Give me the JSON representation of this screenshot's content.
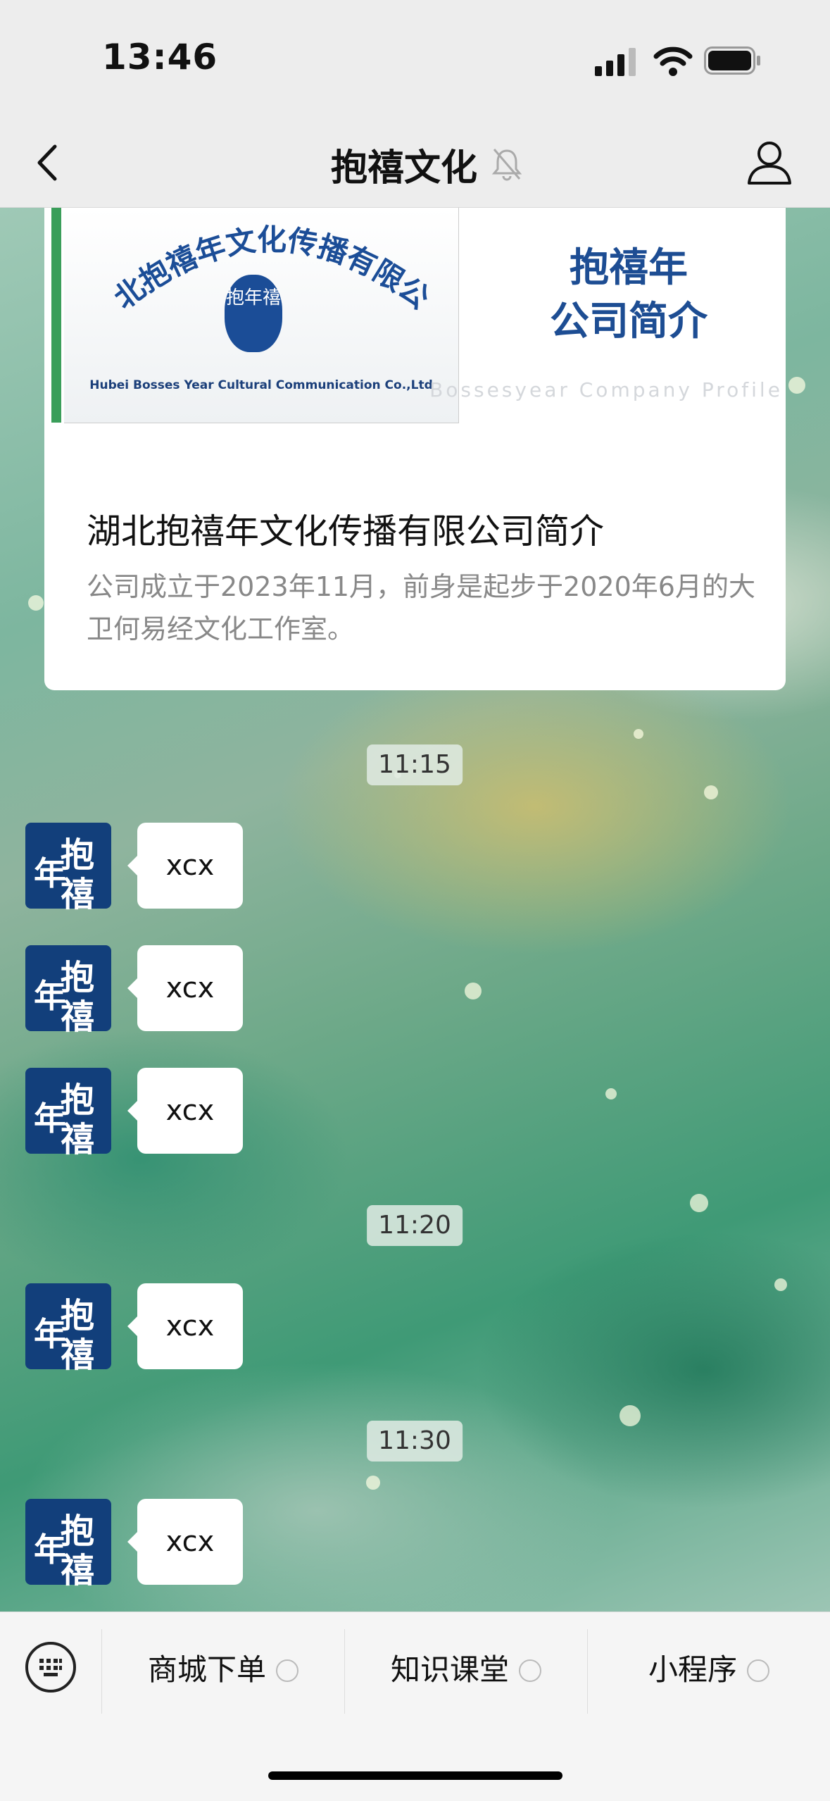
{
  "status_bar": {
    "time": "13:46"
  },
  "nav": {
    "title": "抱禧文化"
  },
  "article": {
    "cover_logo_arc": "湖北抱禧年文化传播有限公司",
    "cover_seal_text": "抱年禧",
    "cover_logo_english": "Hubei Bosses Year Cultural Communication Co.,Ltd",
    "cover_heading_line1": "抱禧年",
    "cover_heading_line2": "公司简介",
    "cover_subheading": "Bossesyear Company Profile",
    "title": "湖北抱禧年文化传播有限公司简介",
    "description": "公司成立于2023年11月，前身是起步于2020年6月的大卫何易经文化工作室。"
  },
  "avatar_chars": {
    "top": "抱",
    "left": "年",
    "bottom": "禧"
  },
  "timestamps": [
    "11:15",
    "11:20",
    "11:30"
  ],
  "messages": [
    "xcx",
    "xcx",
    "xcx",
    "xcx",
    "xcx"
  ],
  "menu": {
    "items": [
      "商城下单",
      "知识课堂",
      "小程序"
    ]
  }
}
